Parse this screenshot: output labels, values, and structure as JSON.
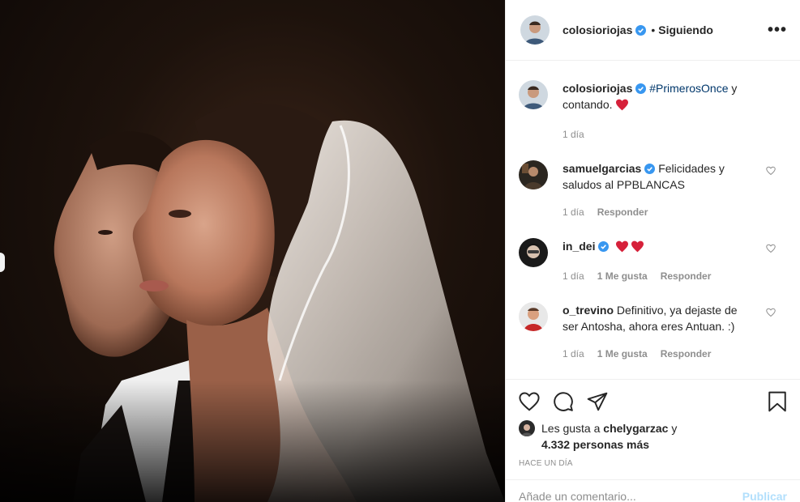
{
  "post": {
    "author": "colosioriojas",
    "separator": "•",
    "follow_label": "Siguiendo",
    "more_label": "•••"
  },
  "caption": {
    "username": "colosioriojas",
    "hashtag": "#PrimerosOnce",
    "text_after_tag": " y contando.",
    "time": "1 día"
  },
  "comments": [
    {
      "username": "samuelgarcias",
      "text": "Felicidades y saludos al PPBLANCAS",
      "time": "1 día",
      "likes": "",
      "reply_label": "Responder",
      "verified": true
    },
    {
      "username": "in_dei",
      "text": "",
      "time": "1 día",
      "likes": "1 Me gusta",
      "reply_label": "Responder",
      "verified": true
    },
    {
      "username": "o_trevino",
      "text": "Definitivo, ya dejaste de ser Antosha, ahora eres Antuan. :)",
      "time": "1 día",
      "likes": "1 Me gusta",
      "reply_label": "Responder",
      "verified": false
    }
  ],
  "likes": {
    "prefix": "Les gusta a ",
    "user": "chelygarzac",
    "middle": " y",
    "count_text": "4.332 personas más"
  },
  "time_ago": "Hace un día",
  "add_comment": {
    "placeholder": "Añade un comentario...",
    "post_label": "Publicar"
  },
  "colors": {
    "verified": "#3897f0",
    "heart_red": "#ed4956",
    "link": "#00376b",
    "secondary": "#8e8e8e"
  }
}
